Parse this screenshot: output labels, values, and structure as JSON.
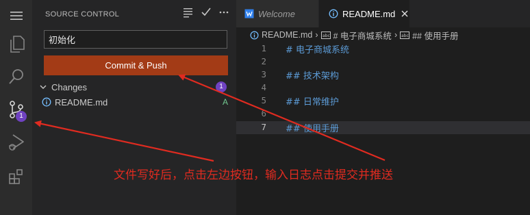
{
  "activity_bar": {
    "items": [
      "menu-icon",
      "explorer-icon",
      "search-icon",
      "source-control-icon",
      "run-debug-icon",
      "extensions-icon"
    ],
    "source_control_badge": "1"
  },
  "sidebar": {
    "title": "SOURCE CONTROL",
    "commit_message": "初始化",
    "commit_button_label": "Commit & Push",
    "changes_label": "Changes",
    "changes_count": "1",
    "files": [
      {
        "name": "README.md",
        "status": "A"
      }
    ]
  },
  "editor": {
    "tabs": [
      {
        "label": "Welcome"
      },
      {
        "label": "README.md"
      }
    ],
    "breadcrumb": [
      "README.md",
      "# 电子商城系统",
      "## 使用手册"
    ],
    "lines": [
      {
        "num": "1",
        "text": "# 电子商城系统"
      },
      {
        "num": "2",
        "text": ""
      },
      {
        "num": "3",
        "text": "## 技术架构"
      },
      {
        "num": "4",
        "text": ""
      },
      {
        "num": "5",
        "text": "## 日常维护"
      },
      {
        "num": "6",
        "text": ""
      },
      {
        "num": "7",
        "text": "## 使用手册"
      }
    ],
    "active_line": "7"
  },
  "annotation": {
    "text": "文件写好后，点击左边按钮，输入日志点击提交并推送",
    "color": "#e02b20"
  },
  "colors": {
    "commit_button": "#a33b16",
    "badge": "#6f42c1",
    "added_status": "#73c991",
    "heading_text": "#5c9bd6"
  }
}
